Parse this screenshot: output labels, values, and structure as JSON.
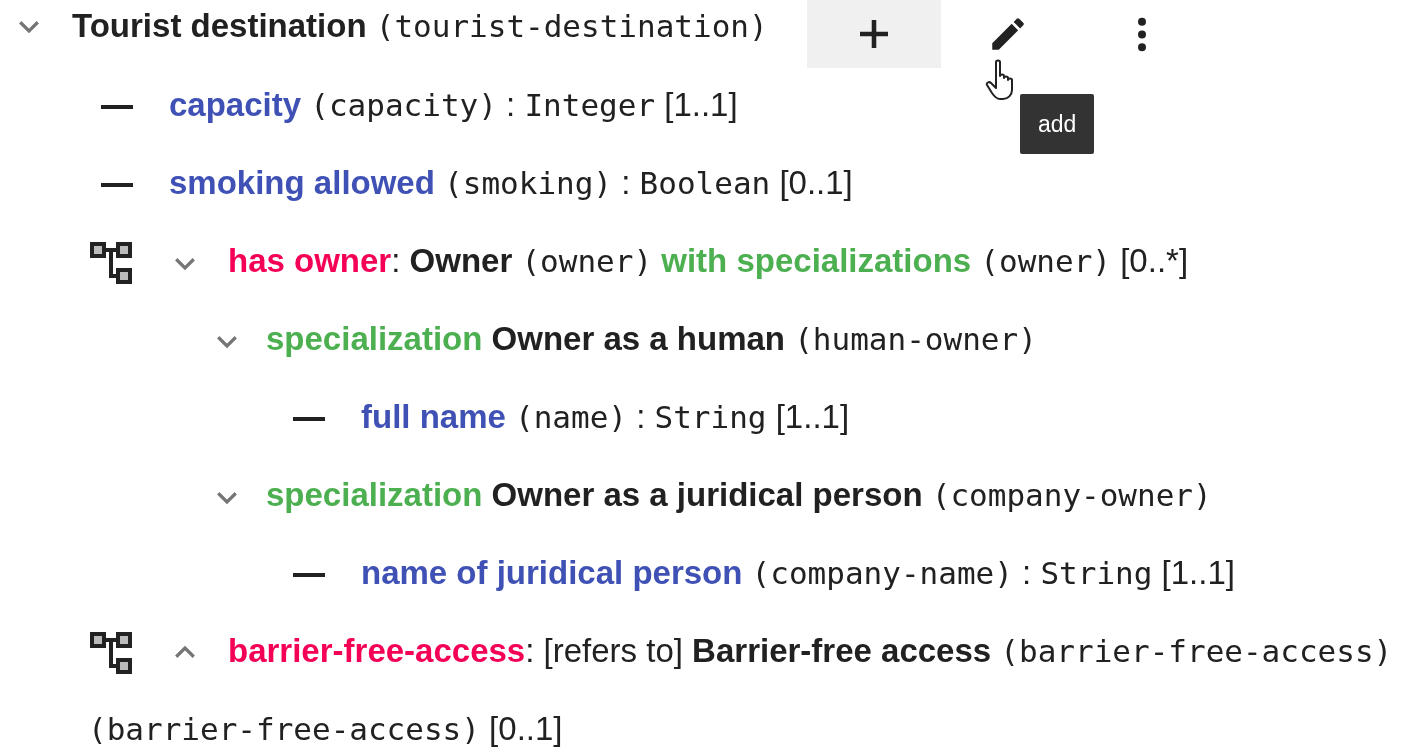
{
  "root": {
    "name": "Tourist destination",
    "id": "(tourist-destination)",
    "expanded": true,
    "actions": [
      {
        "kind": "add",
        "hovered": true
      },
      {
        "kind": "edit",
        "hovered": false
      },
      {
        "kind": "more",
        "hovered": false
      }
    ],
    "tooltip": "add",
    "children": [
      {
        "kind": "attribute",
        "name": "capacity",
        "id": "(capacity)",
        "separator": ":",
        "type": "Integer",
        "cardinality": "[1..1]"
      },
      {
        "kind": "attribute",
        "name": "smoking allowed",
        "id": "(smoking)",
        "separator": ":",
        "type": "Boolean",
        "cardinality": "[0..1]"
      },
      {
        "kind": "association",
        "expanded": true,
        "name": "has owner",
        "separator": ":",
        "target": "Owner",
        "target_id": "(owner)",
        "specializations": "with specializations",
        "specializations_id": "(owner)",
        "cardinality": "[0..*]",
        "children": [
          {
            "kind": "specialization",
            "expanded": true,
            "label": "specialization",
            "name": "Owner as a human",
            "id": "(human-owner)",
            "children": [
              {
                "kind": "attribute",
                "name": "full name",
                "id": "(name)",
                "separator": ":",
                "type": "String",
                "cardinality": "[1..1]"
              }
            ]
          },
          {
            "kind": "specialization",
            "expanded": true,
            "label": "specialization",
            "name": "Owner as a juridical person",
            "id": "(company-owner)",
            "children": [
              {
                "kind": "attribute",
                "name": "name of juridical person",
                "id": "(company-name)",
                "separator": ":",
                "type": "String",
                "cardinality": "[1..1]"
              }
            ]
          }
        ]
      },
      {
        "kind": "association",
        "expanded": false,
        "name": "barrier-free-access",
        "separator": ":",
        "refers": "[refers to]",
        "target": "Barrier-free access",
        "target_id": "(barrier-free-access)",
        "extra_id": "(barrier-free-access)",
        "cardinality": "[0..1]"
      }
    ]
  }
}
